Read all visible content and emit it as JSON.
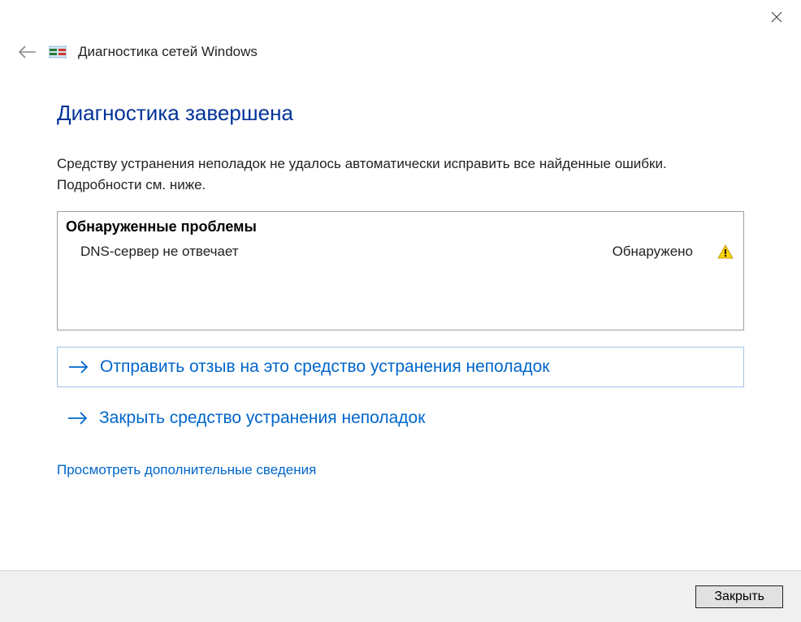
{
  "titlebar": {
    "wizard_name": "Диагностика сетей Windows"
  },
  "main": {
    "heading": "Диагностика завершена",
    "description": "Средству устранения неполадок не удалось автоматически исправить все найденные ошибки. Подробности см. ниже.",
    "problems_header": "Обнаруженные проблемы",
    "problems": [
      {
        "name": "DNS-сервер не отвечает",
        "status": "Обнаружено"
      }
    ],
    "action_feedback": "Отправить отзыв на это средство устранения неполадок",
    "action_close_tool": "Закрыть средство устранения неполадок",
    "detail_link": "Просмотреть дополнительные сведения"
  },
  "footer": {
    "close_label": "Закрыть"
  }
}
